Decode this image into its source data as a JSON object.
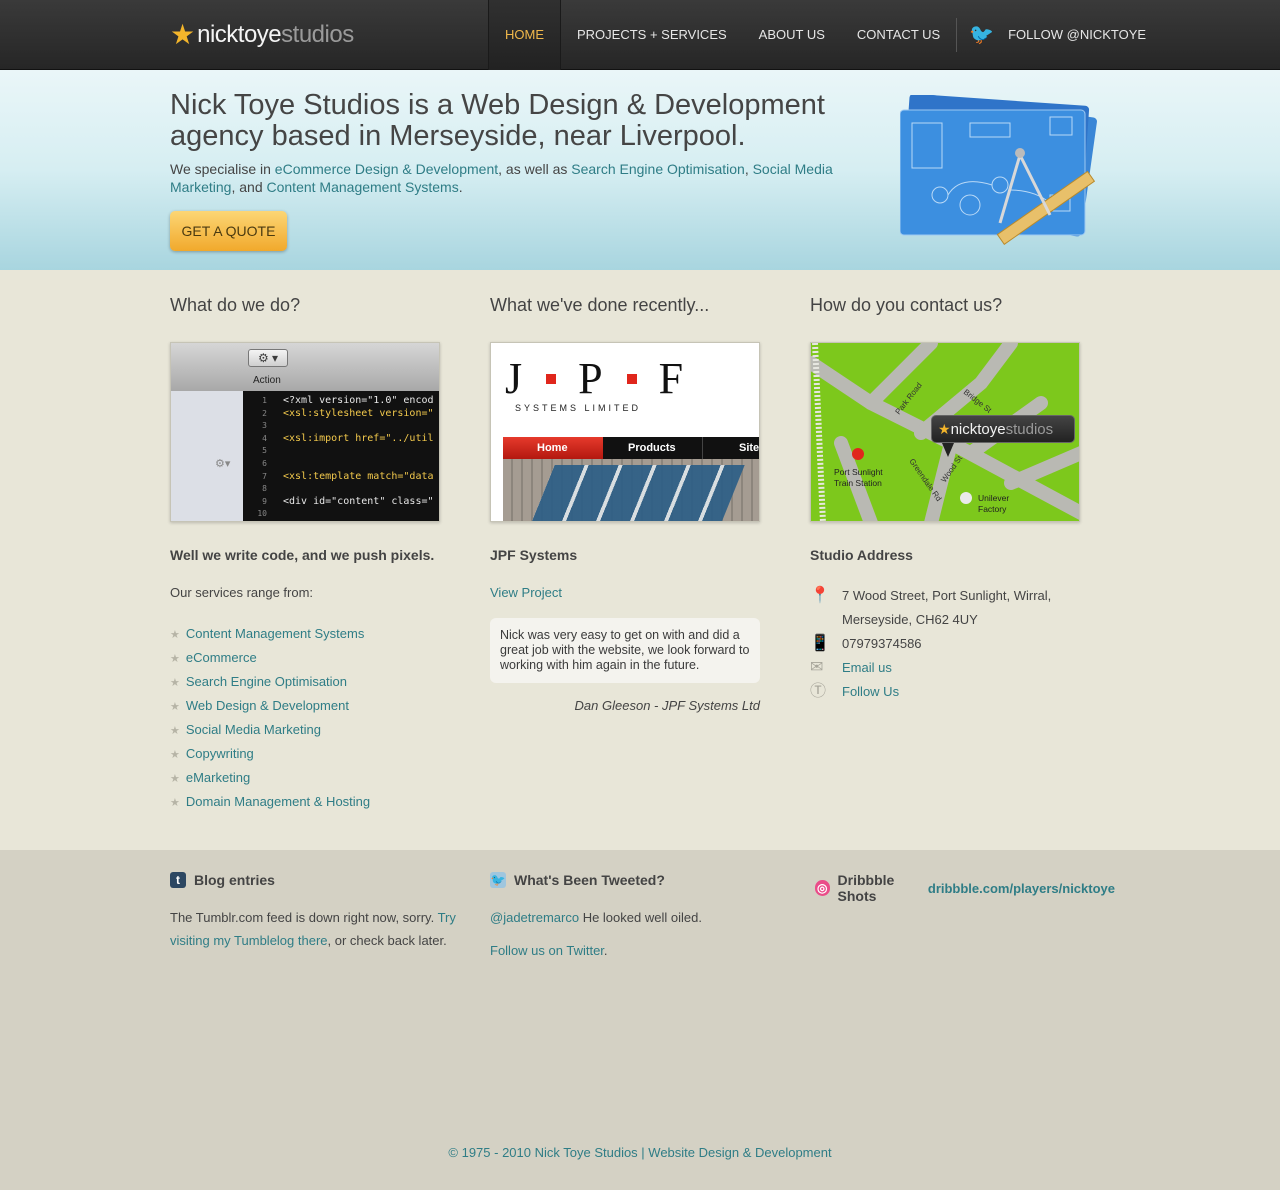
{
  "header": {
    "logo_part1": "nicktoye",
    "logo_part2": "studios",
    "nav": {
      "home": "HOME",
      "projects": "PROJECTS + SERVICES",
      "about": "ABOUT US",
      "contact": "CONTACT US",
      "follow": "FOLLOW @NICKTOYE"
    }
  },
  "hero": {
    "headline": "Nick Toye Studios is a Web Design & Development agency based in Merseyside, near Liverpool.",
    "intro_1": "We specialise in ",
    "link_ecommerce": "eCommerce Design & Development",
    "intro_2": ", as well as ",
    "link_seo": "Search Engine Optimisation",
    "intro_3": ", ",
    "link_smm": "Social Media Marketing",
    "intro_4": ", and ",
    "link_cms": "Content Management Systems",
    "intro_5": ".",
    "quote_button": "GET A QUOTE"
  },
  "col_services": {
    "title": "What do we do?",
    "code_action": "Action",
    "code_lines": [
      {
        "n": "1",
        "t": "<?xml version=\"1.0\" encod"
      },
      {
        "n": "2",
        "t": "<xsl:stylesheet version=\""
      },
      {
        "n": "3",
        "t": ""
      },
      {
        "n": "4",
        "t": "<xsl:import href=\"../util"
      },
      {
        "n": "5",
        "t": ""
      },
      {
        "n": "6",
        "t": ""
      },
      {
        "n": "7",
        "t": "<xsl:template match=\"data"
      },
      {
        "n": "8",
        "t": ""
      },
      {
        "n": "9",
        "t": "<div id=\"content\" class=\""
      },
      {
        "n": "10",
        "t": ""
      }
    ],
    "heading": "Well we write code, and we push pixels.",
    "range_text": "Our services range from:",
    "services": [
      "Content Management Systems",
      "eCommerce",
      "Search Engine Optimisation",
      "Web Design & Development",
      "Social Media Marketing",
      "Copywriting",
      "eMarketing",
      "Domain Management & Hosting"
    ]
  },
  "col_recent": {
    "title": "What we've done recently...",
    "jpf_logo_j": "J",
    "jpf_logo_p": "P",
    "jpf_logo_f": "F",
    "jpf_subtitle": "SYSTEMS LIMITED",
    "jpf_nav": [
      "Home",
      "Products",
      "Site"
    ],
    "project_name": "JPF Systems",
    "view_project": "View Project",
    "testimonial": "Nick was very easy to get on with and did a great job with the website, we look forward to working with him again in the future.",
    "author": "Dan Gleeson - JPF Systems Ltd"
  },
  "col_contact": {
    "title": "How do you contact us?",
    "map_labels": {
      "park_road": "Park Road",
      "bridge_st": "Bridge St",
      "wood_st": "Wood St",
      "greendale": "Greendale Rd",
      "station": "Port Sunlight\nTrain Station",
      "unilever": "Unilever\nFactory",
      "marker_1": "nicktoye",
      "marker_2": "studios"
    },
    "heading": "Studio Address",
    "address_1": "7 Wood Street, Port Sunlight, Wirral,",
    "address_2": "Merseyside, CH62 4UY",
    "phone": "07979374586",
    "email": "Email us",
    "follow": "Follow Us"
  },
  "footer": {
    "blog_title": "Blog entries",
    "blog_text_1": "The Tumblr.com feed is down right now, sorry. ",
    "blog_link": "Try visiting my Tumblelog there",
    "blog_text_2": ", or check back later.",
    "tweets_title": "What's Been Tweeted?",
    "tweet_handle": "@jadetremarco",
    "tweet_text": " He looked well oiled.",
    "follow_link": "Follow us on Twitter",
    "follow_period": ".",
    "dribbble_title": "Dribbble Shots ",
    "dribbble_link": "dribbble.com/players/nicktoye",
    "copyright": "© 1975 - 2010 Nick Toye Studios | Website Design & Development"
  }
}
